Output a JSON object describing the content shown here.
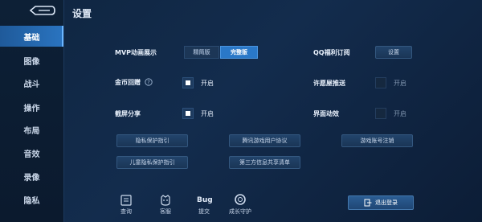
{
  "header": {
    "title": "设置"
  },
  "sidebar": {
    "items": [
      {
        "label": "基础",
        "active": true
      },
      {
        "label": "图像",
        "active": false
      },
      {
        "label": "战斗",
        "active": false
      },
      {
        "label": "操作",
        "active": false
      },
      {
        "label": "布局",
        "active": false
      },
      {
        "label": "音效",
        "active": false
      },
      {
        "label": "录像",
        "active": false
      },
      {
        "label": "隐私",
        "active": false
      }
    ]
  },
  "settings": {
    "mvp": {
      "label": "MVP动画展示",
      "options": [
        "精简版",
        "完整版"
      ],
      "selected": "完整版"
    },
    "qq": {
      "label": "QQ福利订阅",
      "button": "设置"
    },
    "gold": {
      "label": "金币回赠",
      "state": "开启",
      "checked": true
    },
    "heart": {
      "label": "许愿屋推送",
      "state": "开启",
      "checked": false
    },
    "screenshot": {
      "label": "截屏分享",
      "state": "开启",
      "checked": true
    },
    "ui_anim": {
      "label": "界面动效",
      "state": "开启",
      "checked": false
    }
  },
  "links": {
    "privacy": "隐私保护指引",
    "user_agreement": "腾讯游戏用户协议",
    "account_cancel": "游戏账号注销",
    "child_privacy": "儿童隐私保护指引",
    "third_party": "第三方信息共享清单"
  },
  "bottom": {
    "query": "查询",
    "service": "客服",
    "bug_title": "Bug",
    "bug_label": "提交",
    "guardian": "成长守护",
    "logout": "退出登录"
  },
  "colors": {
    "accent": "#2a78c8",
    "active_nav": "#2a74c0",
    "background": "#132c4d"
  }
}
